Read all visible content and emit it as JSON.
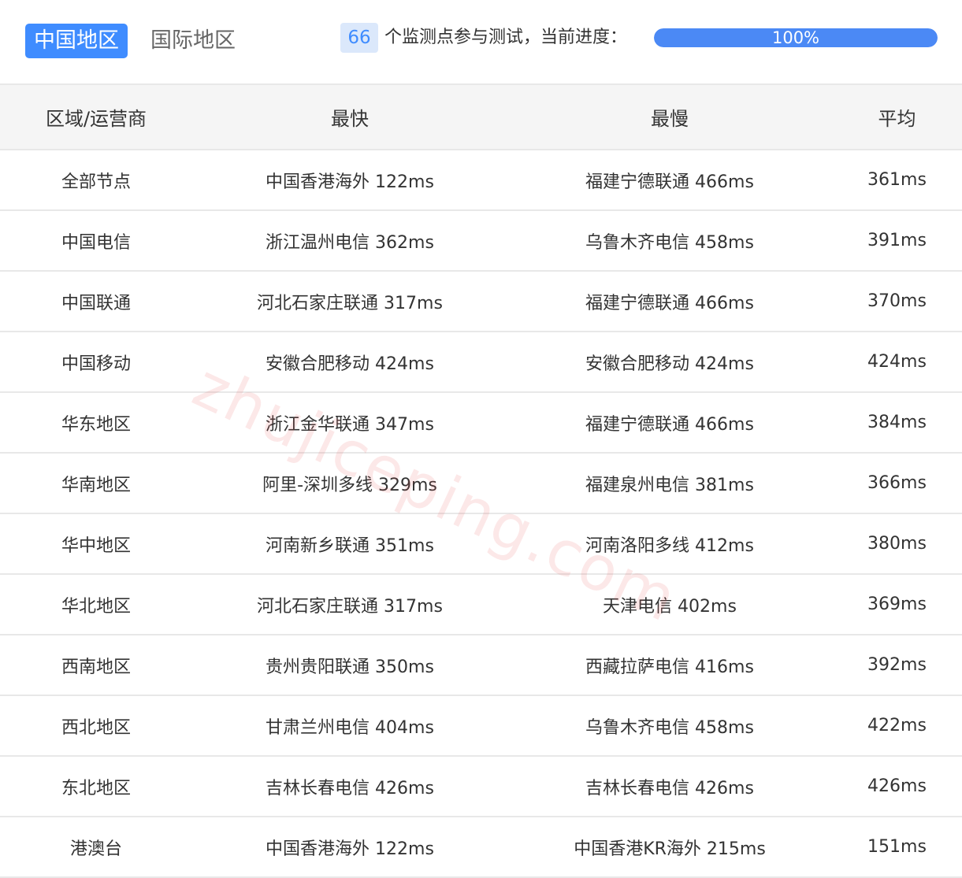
{
  "tabs": [
    {
      "label": "中国地区",
      "active": true
    },
    {
      "label": "国际地区",
      "active": false
    }
  ],
  "status": {
    "node_count": "66",
    "text": "个监测点参与测试，当前进度：",
    "progress_label": "100%",
    "progress_fraction": 1.0
  },
  "table": {
    "headers": [
      "区域/运营商",
      "最快",
      "最慢",
      "平均"
    ],
    "rows": [
      [
        "全部节点",
        "中国香港海外 122ms",
        "福建宁德联通 466ms",
        "361ms"
      ],
      [
        "中国电信",
        "浙江温州电信 362ms",
        "乌鲁木齐电信 458ms",
        "391ms"
      ],
      [
        "中国联通",
        "河北石家庄联通 317ms",
        "福建宁德联通 466ms",
        "370ms"
      ],
      [
        "中国移动",
        "安徽合肥移动 424ms",
        "安徽合肥移动 424ms",
        "424ms"
      ],
      [
        "华东地区",
        "浙江金华联通 347ms",
        "福建宁德联通 466ms",
        "384ms"
      ],
      [
        "华南地区",
        "阿里-深圳多线 329ms",
        "福建泉州电信 381ms",
        "366ms"
      ],
      [
        "华中地区",
        "河南新乡联通 351ms",
        "河南洛阳多线 412ms",
        "380ms"
      ],
      [
        "华北地区",
        "河北石家庄联通 317ms",
        "天津电信 402ms",
        "369ms"
      ],
      [
        "西南地区",
        "贵州贵阳联通 350ms",
        "西藏拉萨电信 416ms",
        "392ms"
      ],
      [
        "西北地区",
        "甘肃兰州电信 404ms",
        "乌鲁木齐电信 458ms",
        "422ms"
      ],
      [
        "东北地区",
        "吉林长春电信 426ms",
        "吉林长春电信 426ms",
        "426ms"
      ],
      [
        "港澳台",
        "中国香港海外 122ms",
        "中国香港KR海外 215ms",
        "151ms"
      ]
    ]
  },
  "watermark": "zhujiceping.com",
  "colors": {
    "accent": "#3f8cff",
    "badge_bg": "#dbe8fb",
    "progress_fill": "#4b89f5"
  }
}
